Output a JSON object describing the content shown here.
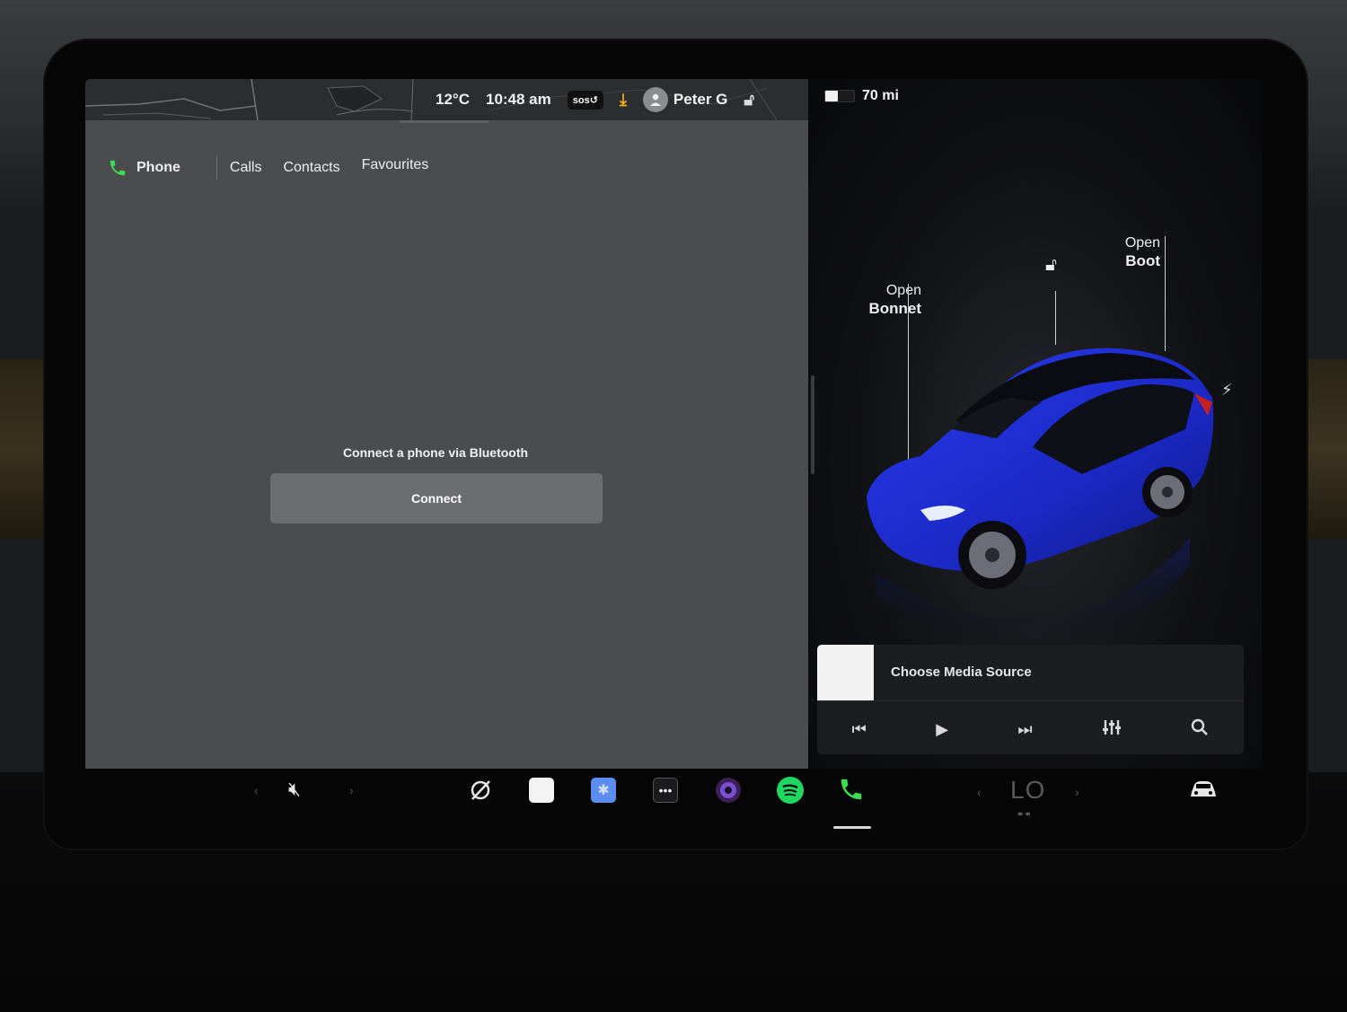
{
  "status": {
    "temperature": "12°C",
    "time": "10:48 am",
    "sos_label": "sos",
    "user_name": "Peter G",
    "range": "70 mi",
    "battery_level": 0.45
  },
  "phone": {
    "app_label": "Phone",
    "tabs": [
      "Calls",
      "Contacts",
      "Favourites"
    ],
    "connect_message": "Connect a phone via Bluetooth",
    "connect_button": "Connect"
  },
  "vehicle": {
    "bonnet_line1": "Open",
    "bonnet_line2": "Bonnet",
    "boot_line1": "Open",
    "boot_line2": "Boot",
    "body_color": "#1f2fd6"
  },
  "media": {
    "title": "Choose Media Source",
    "controls": [
      "previous-track-icon",
      "play-icon",
      "next-track-icon",
      "equalizer-icon",
      "search-icon"
    ]
  },
  "taskbar": {
    "climate_temp": "LO",
    "apps": [
      "mute-icon",
      "camera-off-icon",
      "notes-icon",
      "bluetooth-icon",
      "more-icon",
      "camera-app-icon",
      "spotify-icon",
      "phone-icon",
      "car-icon"
    ]
  },
  "colors": {
    "accent_green": "#3ddc52",
    "spotify_green": "#1ed760",
    "bluetooth_blue": "#5c8df0",
    "download_yellow": "#f2b21e"
  }
}
